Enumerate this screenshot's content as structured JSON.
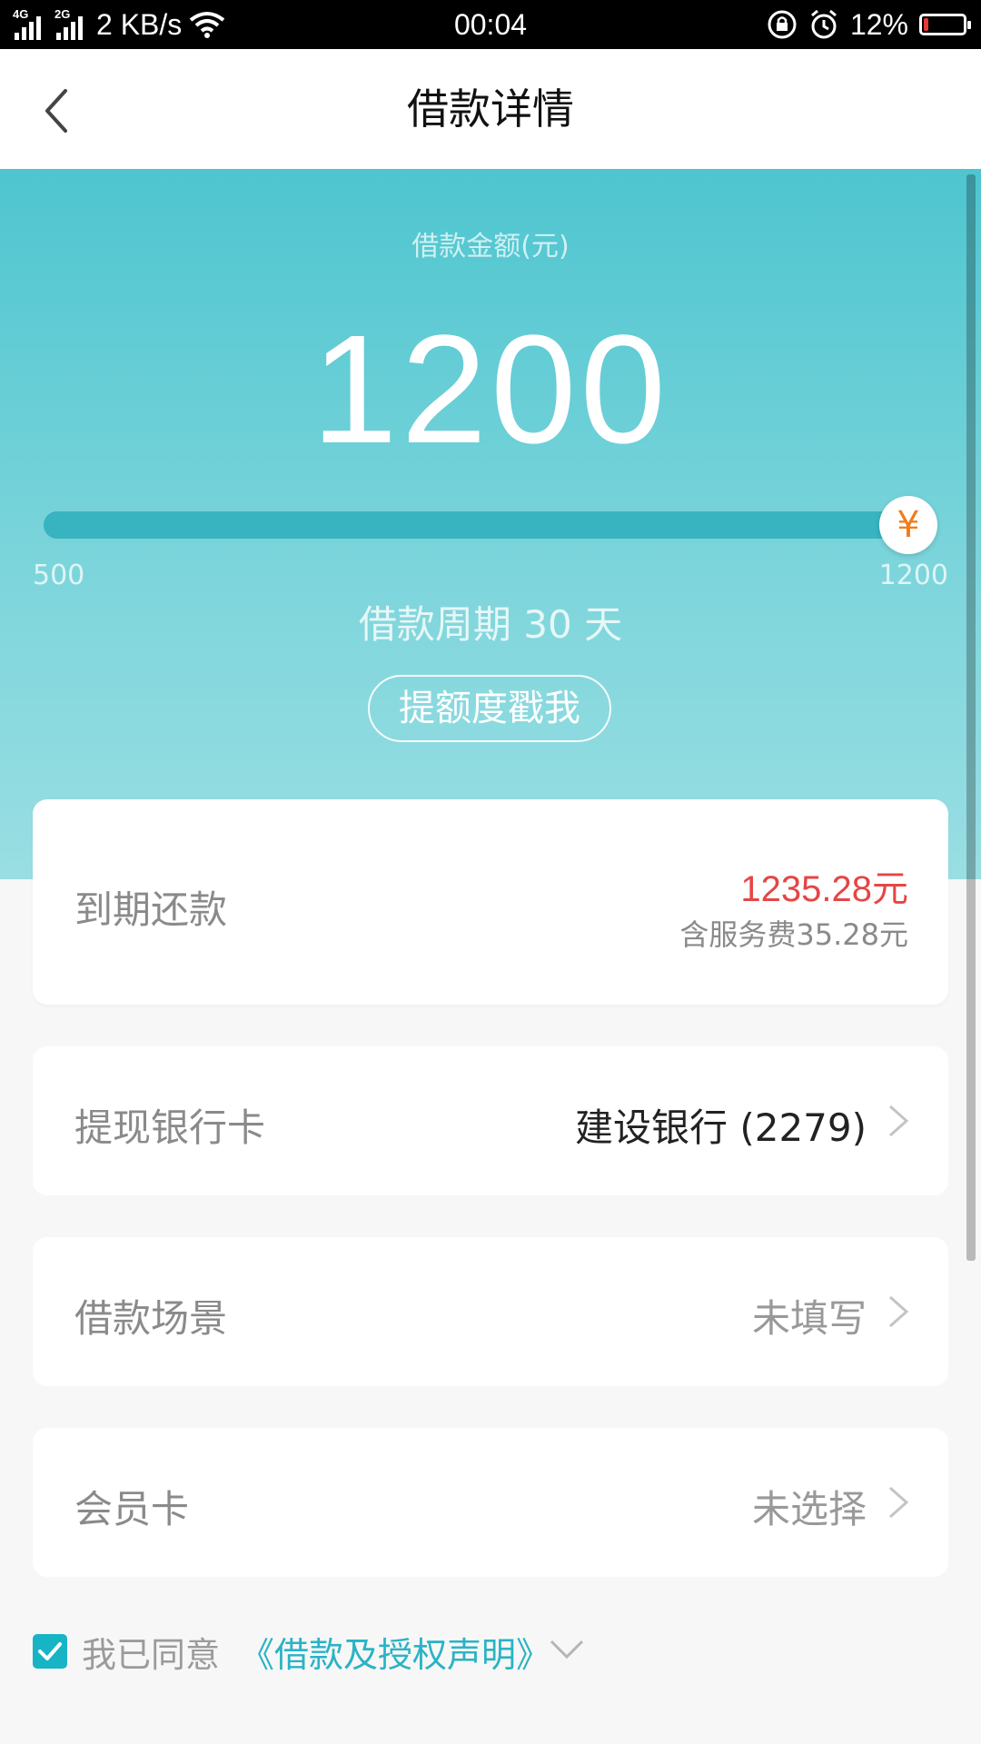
{
  "status_bar": {
    "net1": "4G",
    "net2": "2G",
    "speed": "2 KB/s",
    "time": "00:04",
    "battery": "12%",
    "battery_level": 0.12,
    "battery_color": "#e53935"
  },
  "header": {
    "title": "借款详情"
  },
  "loan": {
    "amount_label": "借款金额(元)",
    "amount": "1200",
    "slider_min": "500",
    "slider_max": "1200",
    "slider_value": 1200,
    "knob_symbol": "¥",
    "period": "借款周期 30 天",
    "raise_button": "提额度戳我"
  },
  "repayment": {
    "label": "到期还款",
    "amount": "1235.28元",
    "fee_note": "含服务费35.28元"
  },
  "bank_card": {
    "label": "提现银行卡",
    "value": "建设银行 (2279)"
  },
  "scenario": {
    "label": "借款场景",
    "value": "未填写"
  },
  "member_card": {
    "label": "会员卡",
    "value": "未选择"
  },
  "agreement": {
    "checked": true,
    "text": "我已同意",
    "link": "《借款及授权声明》"
  },
  "colors": {
    "accent": "#2ab3c5",
    "price": "#e64545",
    "knob_symbol": "#f07d1c"
  }
}
